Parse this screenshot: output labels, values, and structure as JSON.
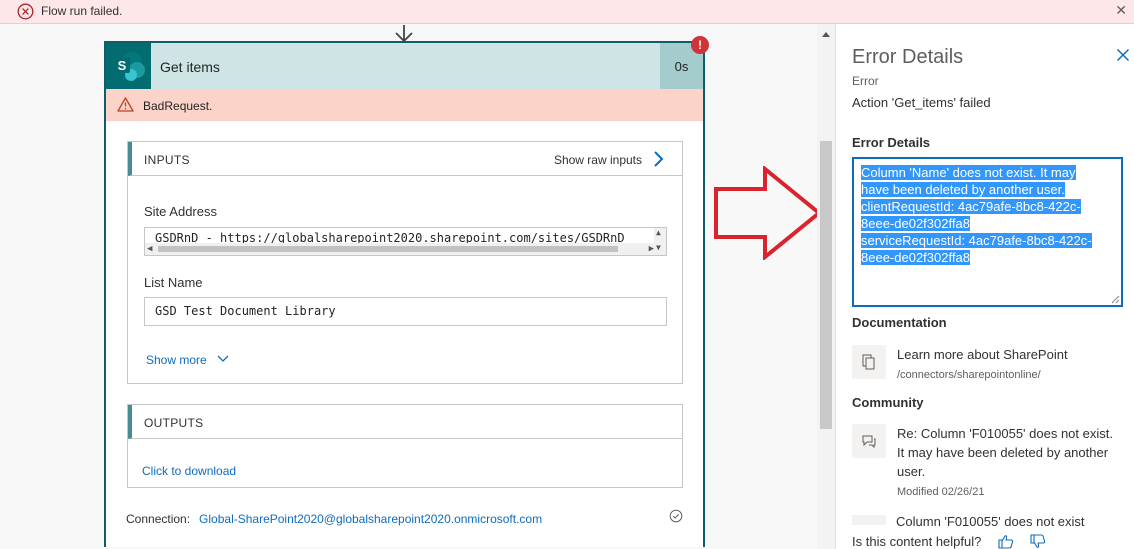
{
  "banner": {
    "message": "Flow run failed."
  },
  "card": {
    "title": "Get items",
    "duration": "0s",
    "badge": "!",
    "status": "BadRequest.",
    "inputs": {
      "label": "INPUTS",
      "raw_link": "Show raw inputs",
      "site_address_label": "Site Address",
      "site_address_prefix": "GSDRnD - ",
      "site_address_url": "https://globalsharepoint2020.sharepoint.com/sites/GSDRnD",
      "list_name_label": "List Name",
      "list_name_value": "GSD Test Document Library",
      "show_more": "Show more"
    },
    "outputs": {
      "label": "OUTPUTS",
      "download_link": "Click to download"
    },
    "connection": {
      "label": "Connection:",
      "account": "Global-SharePoint2020@globalsharepoint2020.onmicrosoft.com"
    }
  },
  "panel": {
    "title": "Error Details",
    "error_word": "Error",
    "action_failed": "Action 'Get_items' failed",
    "error_details_heading": "Error Details",
    "error_lines": [
      "Column 'Name' does not exist. It may",
      "have been deleted by another user.",
      "clientRequestId: 4ac79afe-8bc8-422c-",
      "8eee-de02f302ffa8",
      "serviceRequestId: 4ac79afe-8bc8-422c-",
      "8eee-de02f302ffa8"
    ],
    "documentation_heading": "Documentation",
    "doc_link": "Learn more about SharePoint",
    "doc_path": "/connectors/sharepointonline/",
    "community_heading": "Community",
    "community_post": "Re: Column 'F010055' does not exist. It may have been deleted by another user.",
    "community_modified": "Modified 02/26/21",
    "partial_post": "Column 'F010055' does not exist",
    "helpful_prompt": "Is this content helpful?"
  },
  "colors": {
    "card_border": "#0f5d6a",
    "card_header": "#cfe5e5",
    "error_banner": "#fde7e9",
    "bad_request_bg": "#fbd3c9",
    "link": "#0f6cbd",
    "selection": "#3297fd",
    "arrow_red": "#d9232e"
  },
  "icons": [
    "error-circle-icon",
    "close-icon",
    "down-arrow-icon",
    "sharepoint-icon",
    "warning-icon",
    "chevron-right-icon",
    "chevron-down-icon",
    "check-circle-icon",
    "documentation-icon",
    "community-icon",
    "thumbs-up-icon",
    "thumbs-down-icon",
    "red-arrow-icon"
  ]
}
